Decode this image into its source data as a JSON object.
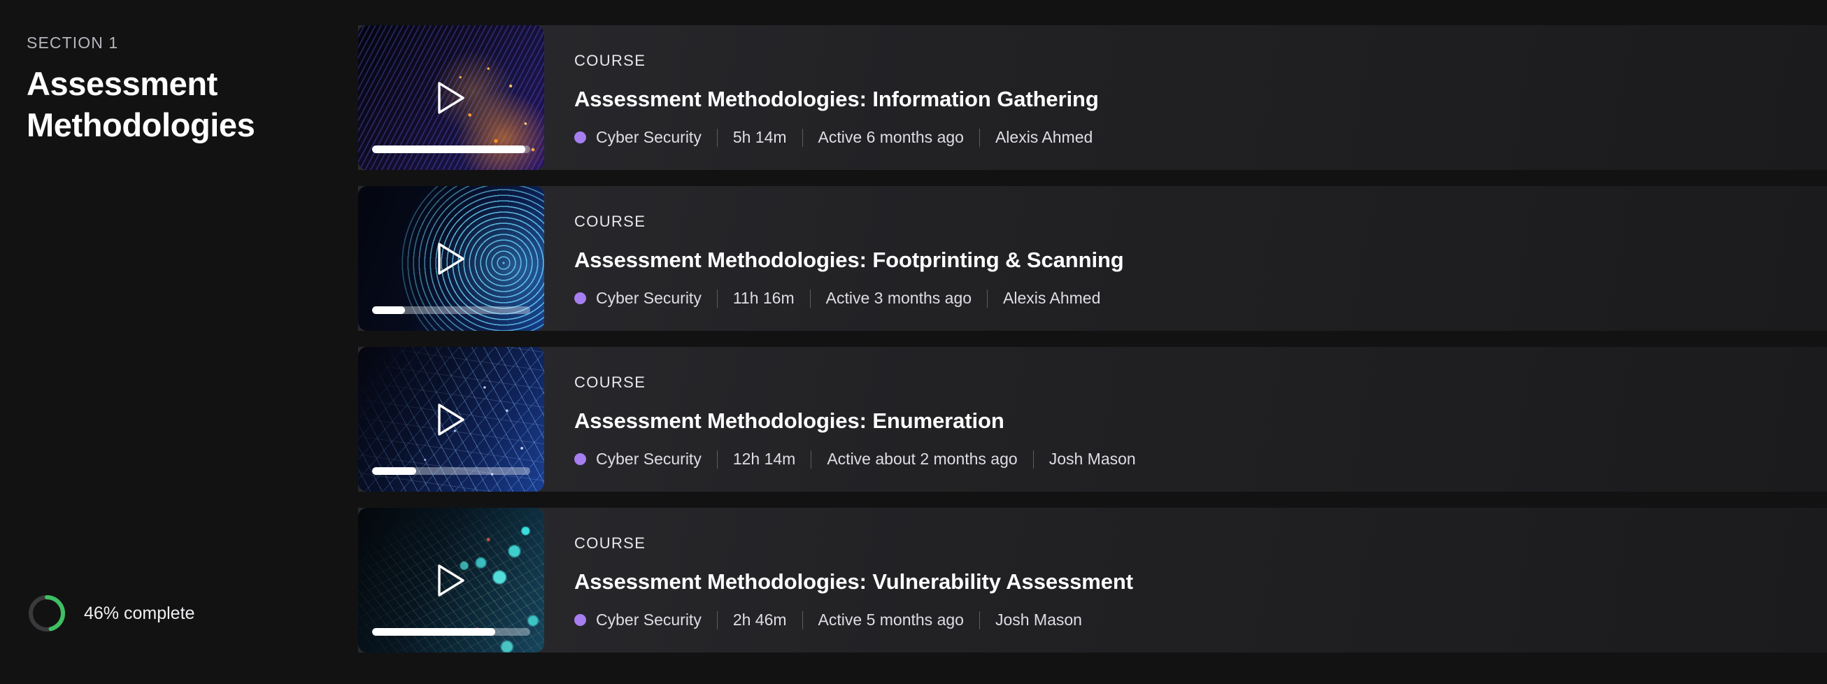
{
  "sidebar": {
    "section_label": "SECTION 1",
    "section_title": "Assessment Methodologies",
    "progress": {
      "percent": 46,
      "label": "46% complete",
      "track_color": "#3a3a3c",
      "fill_color": "#3fbf63"
    }
  },
  "accent": {
    "category_dot": "#a77ef0",
    "progress_fill": "#ffffff"
  },
  "courses": [
    {
      "kicker": "COURSE",
      "title": "Assessment Methodologies: Information Gathering",
      "category": "Cyber Security",
      "duration": "5h 14m",
      "activity": "Active 6 months ago",
      "author": "Alexis Ahmed",
      "thumbnail_progress_percent": 97,
      "thumbnail_art": "circuit-board-amber-code",
      "play_icon": "play-triangle-icon"
    },
    {
      "kicker": "COURSE",
      "title": "Assessment Methodologies: Footprinting & Scanning",
      "category": "Cyber Security",
      "duration": "11h 16m",
      "activity": "Active 3 months ago",
      "author": "Alexis Ahmed",
      "thumbnail_progress_percent": 21,
      "thumbnail_art": "blue-circular-circuit",
      "play_icon": "play-triangle-icon"
    },
    {
      "kicker": "COURSE",
      "title": "Assessment Methodologies: Enumeration",
      "category": "Cyber Security",
      "duration": "12h 14m",
      "activity": "Active about 2 months ago",
      "author": "Josh Mason",
      "thumbnail_progress_percent": 28,
      "thumbnail_art": "blue-particle-mesh",
      "play_icon": "play-triangle-icon"
    },
    {
      "kicker": "COURSE",
      "title": "Assessment Methodologies: Vulnerability Assessment",
      "category": "Cyber Security",
      "duration": "2h 46m",
      "activity": "Active 5 months ago",
      "author": "Josh Mason",
      "thumbnail_progress_percent": 78,
      "thumbnail_art": "teal-lock-network",
      "play_icon": "play-triangle-icon"
    }
  ]
}
